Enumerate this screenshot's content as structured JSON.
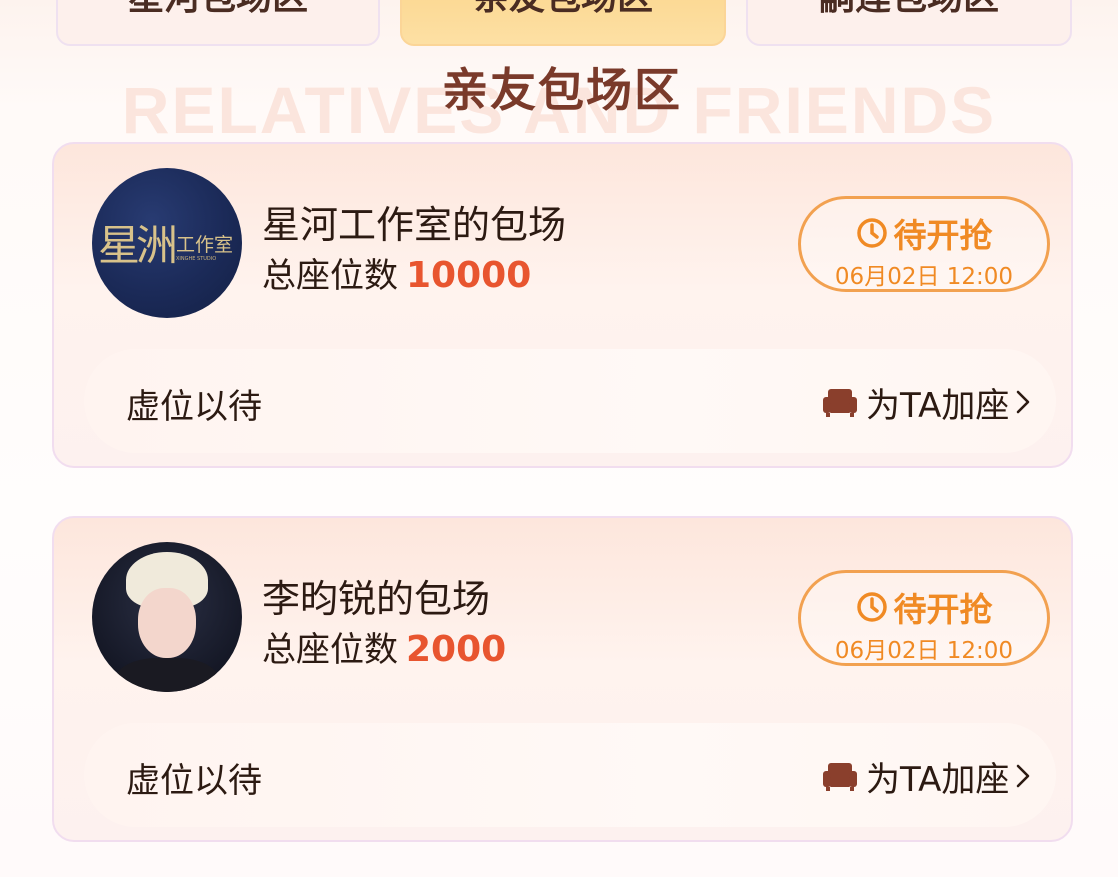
{
  "tabs": [
    {
      "label": "星河包场区"
    },
    {
      "label": "亲友包场区"
    },
    {
      "label": "嗣莲包场区"
    }
  ],
  "section": {
    "title": "亲友包场区",
    "watermark": "RELATIVES AND FRIENDS"
  },
  "cards": [
    {
      "avatar": {
        "big": "星洲",
        "small": "工作室",
        "en": "XINGHE STUDIO"
      },
      "name": "星河工作室的包场",
      "seat_label": "总座位数",
      "seat_count": "10000",
      "status_label": "待开抢",
      "status_time": "06月02日 12:00",
      "footer_text": "虚位以待",
      "add_seat_label": "为TA加座"
    },
    {
      "name": "李昀锐的包场",
      "seat_label": "总座位数",
      "seat_count": "2000",
      "status_label": "待开抢",
      "status_time": "06月02日 12:00",
      "footer_text": "虚位以待",
      "add_seat_label": "为TA加座"
    }
  ],
  "colors": {
    "accent_orange": "#f08a24",
    "seat_count_red": "#e8552f",
    "active_tab": "#fbd58c",
    "heading_brown": "#7a3a2a"
  }
}
